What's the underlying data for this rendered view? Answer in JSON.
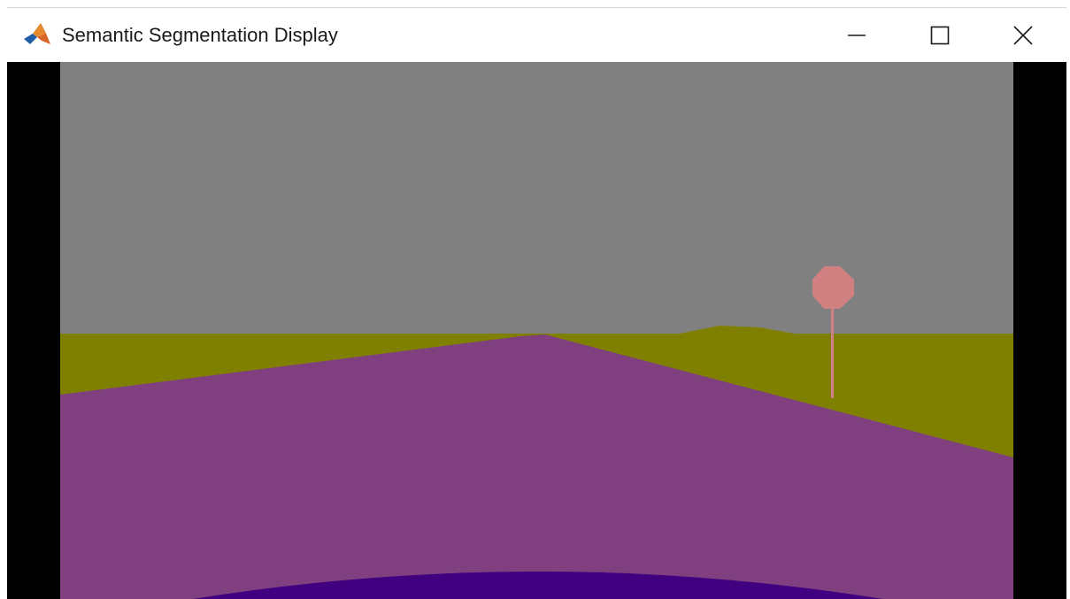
{
  "window": {
    "title": "Semantic Segmentation Display",
    "app_icon": "matlab-icon",
    "controls": {
      "minimize_icon": "minimize-icon",
      "maximize_icon": "maximize-icon",
      "close_icon": "close-icon"
    }
  },
  "segmentation": {
    "colors": {
      "sky": "#808080",
      "terrain": "#808000",
      "road": "#804080",
      "ego_vehicle": "#400080",
      "traffic_sign": "#D08080",
      "border": "#000000"
    },
    "visible_regions": [
      "sky",
      "terrain",
      "road",
      "ego_vehicle",
      "traffic_sign"
    ]
  }
}
